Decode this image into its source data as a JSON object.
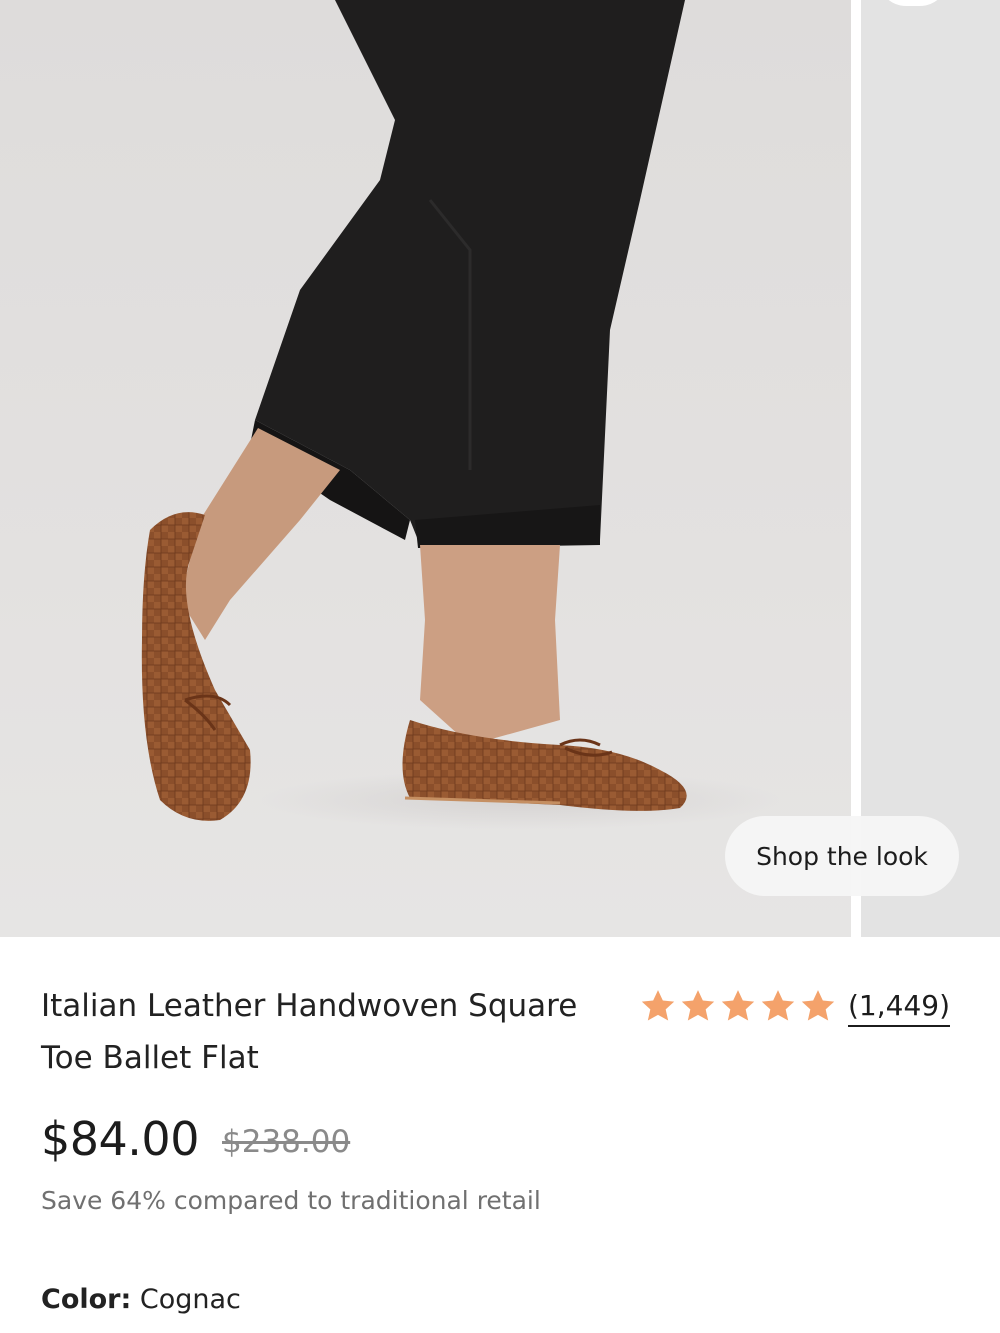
{
  "gallery": {
    "shop_the_look_label": "Shop the look"
  },
  "product": {
    "title": "Italian Leather Handwoven Square Toe Ballet Flat",
    "rating": {
      "stars": 5,
      "review_count": "(1,449)",
      "star_color": "#f4a26b"
    },
    "price": "$84.00",
    "original_price": "$238.00",
    "savings_note": "Save 64% compared to traditional retail",
    "color_label": "Color:",
    "color_value": "Cognac"
  },
  "colors": {
    "shoe": "#8b4f2b",
    "pants": "#1e1d1d",
    "background": "#e2e0df"
  }
}
